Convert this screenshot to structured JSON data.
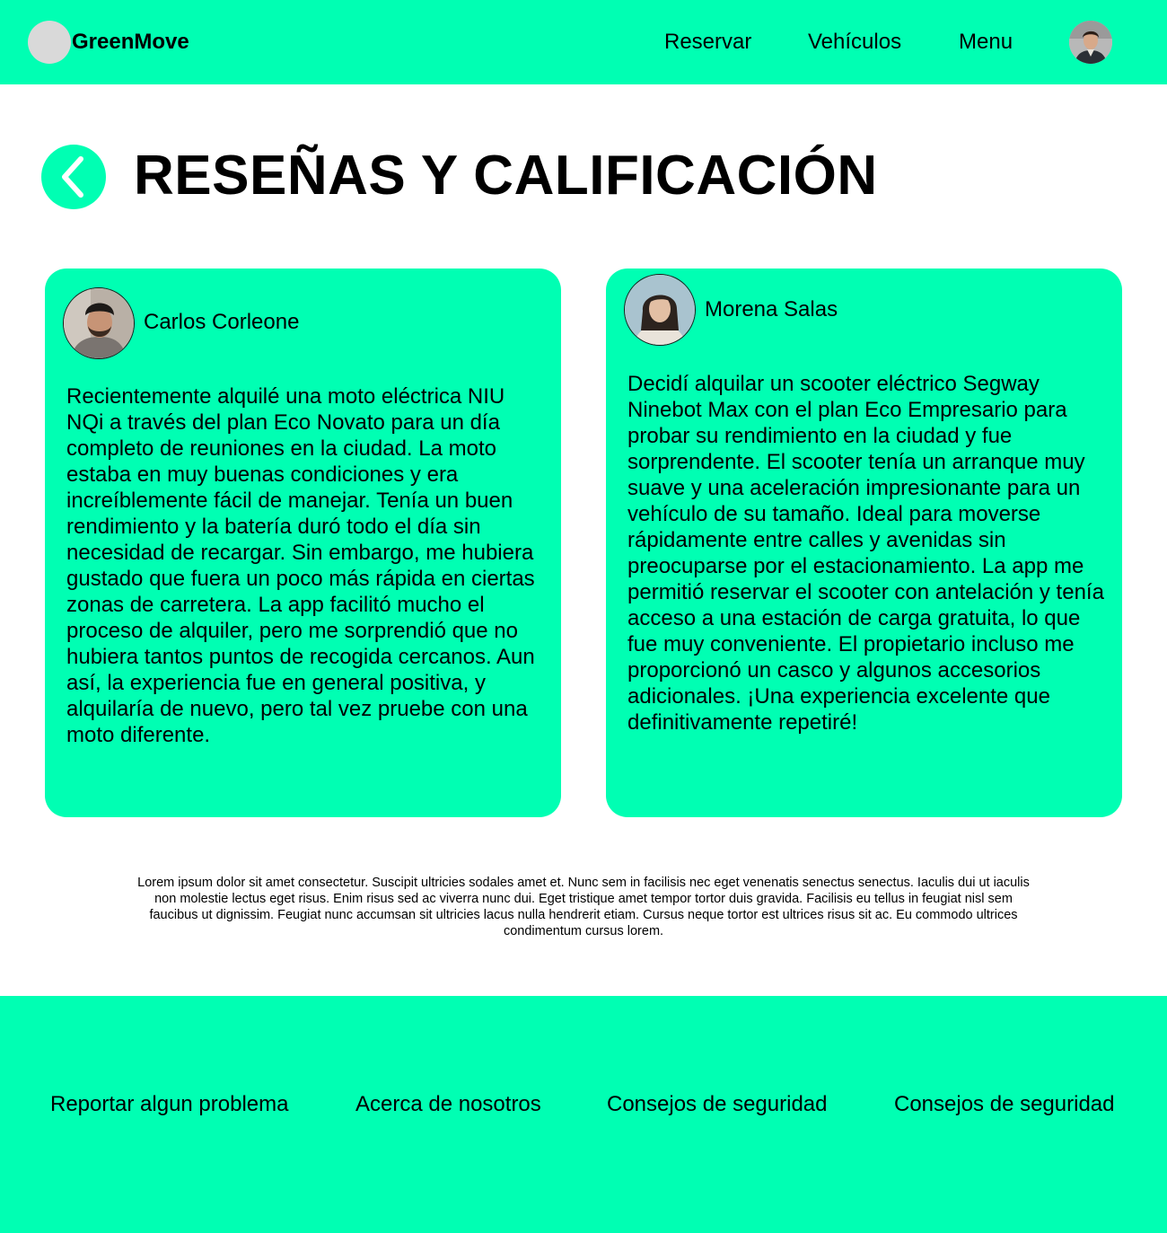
{
  "header": {
    "brand": "GreenMove",
    "nav": [
      "Reservar",
      "Vehículos",
      "Menu"
    ]
  },
  "page": {
    "title": "RESEÑAS Y CALIFICACIÓN"
  },
  "reviews": [
    {
      "name": "Carlos Corleone",
      "text": "Recientemente alquilé una moto eléctrica NIU NQi a través del plan Eco Novato para un día completo de reuniones en la ciudad. La moto estaba en muy buenas condiciones y era increíblemente fácil de manejar. Tenía un buen rendimiento y la batería duró todo el día sin necesidad de recargar. Sin embargo, me hubiera gustado que fuera un poco más rápida en ciertas zonas de carretera. La app facilitó mucho el proceso de alquiler, pero me sorprendió que no hubiera tantos puntos de recogida cercanos. Aun así, la experiencia fue en general positiva, y alquilaría de nuevo, pero tal vez pruebe con una moto diferente."
    },
    {
      "name": "Morena Salas",
      "text": "Decidí alquilar un scooter eléctrico Segway Ninebot Max con el plan Eco Empresario para probar su rendimiento en la ciudad y fue sorprendente. El scooter tenía un arranque muy suave y una aceleración impresionante para un vehículo de su tamaño. Ideal para moverse rápidamente entre calles y avenidas sin preocuparse por el estacionamiento. La app me permitió reservar el scooter con antelación y tenía acceso a una estación de carga gratuita, lo que fue muy conveniente. El propietario incluso me proporcionó un casco y algunos accesorios adicionales. ¡Una experiencia excelente que definitivamente repetiré!"
    }
  ],
  "lorem": "Lorem ipsum dolor sit amet consectetur. Suscipit ultricies sodales amet et. Nunc sem in facilisis nec eget venenatis senectus senectus. Iaculis dui ut iaculis non molestie lectus eget risus. Enim risus sed ac viverra nunc dui. Eget tristique amet tempor tortor duis gravida. Facilisis eu tellus in feugiat nisl sem faucibus ut dignissim. Feugiat nunc accumsan sit ultricies lacus nulla hendrerit etiam. Cursus neque tortor est ultrices risus sit ac. Eu commodo ultrices condimentum cursus lorem.",
  "footer": {
    "links": [
      "Reportar algun problema",
      "Acerca de nosotros",
      "Consejos de seguridad",
      "Consejos de seguridad"
    ]
  },
  "colors": {
    "accent": "#00FFB3",
    "placeholder": "#D9D9D9"
  }
}
